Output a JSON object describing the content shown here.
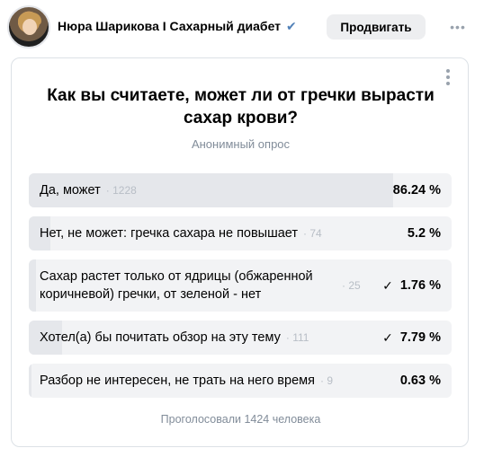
{
  "header": {
    "author_name": "Нюра Шарикова I Сахарный диабет",
    "verified_icon": "verified-checkmark",
    "promote_label": "Продвигать",
    "more_icon": "more-horizontal"
  },
  "poll": {
    "title": "Как вы считаете, может ли от гречки вырасти сахар крови?",
    "type_label": "Анонимный опрос",
    "options": [
      {
        "text": "Да, может",
        "votes": "1228",
        "percent_label": "86.24 %",
        "percent": 86.24,
        "checked": false
      },
      {
        "text": "Нет, не может: гречка сахара не повышает",
        "votes": "74",
        "percent_label": "5.2 %",
        "percent": 5.2,
        "checked": false
      },
      {
        "text": "Сахар растет только от ядрицы (обжаренной коричневой) гречки, от зеленой - нет",
        "votes": "25",
        "percent_label": "1.76 %",
        "percent": 1.76,
        "checked": true
      },
      {
        "text": "Хотел(а) бы почитать обзор на эту тему",
        "votes": "111",
        "percent_label": "7.79 %",
        "percent": 7.79,
        "checked": true
      },
      {
        "text": "Разбор не интересен, не трать на него время",
        "votes": "9",
        "percent_label": "0.63 %",
        "percent": 0.63,
        "checked": false
      }
    ],
    "total_label": "Проголосовали 1424 человека"
  },
  "colors": {
    "accent": "#5181b8",
    "option_bg": "#f2f3f5",
    "option_fill": "#e5e7eb",
    "muted_text": "#818c99"
  }
}
